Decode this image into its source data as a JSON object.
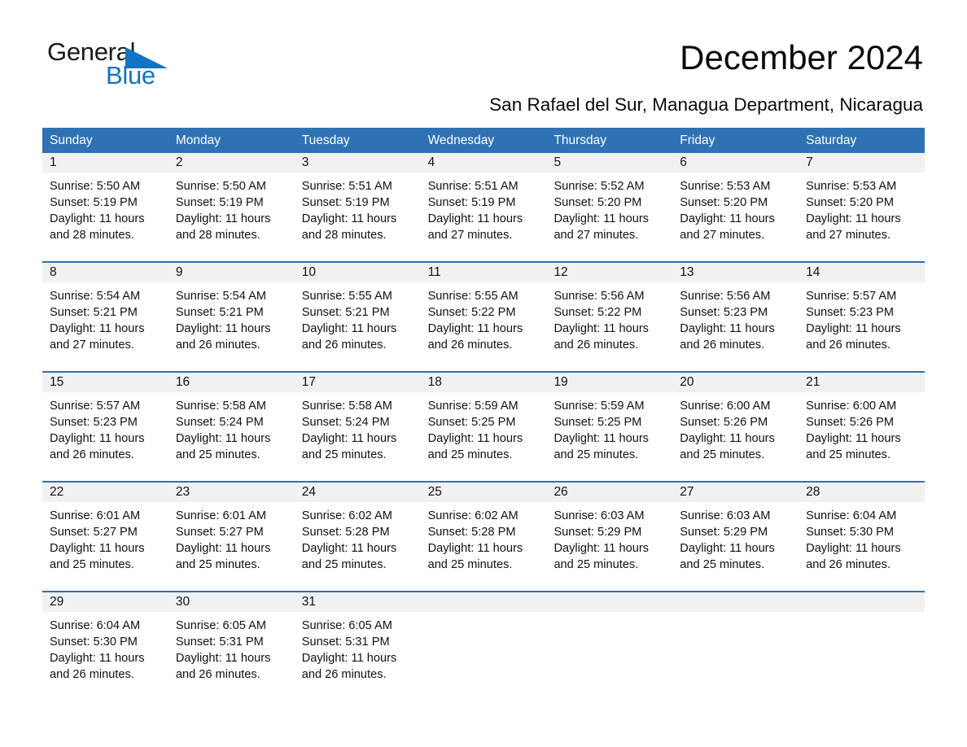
{
  "brand": {
    "name_part1": "General",
    "name_part2": "Blue",
    "triangle_color": "#1273c4"
  },
  "header": {
    "title": "December 2024",
    "subtitle": "San Rafael del Sur, Managua Department, Nicaragua"
  },
  "calendar": {
    "accent_color": "#2e72b4",
    "daynum_band_color": "#f1f1f1",
    "weekday_headers": [
      "Sunday",
      "Monday",
      "Tuesday",
      "Wednesday",
      "Thursday",
      "Friday",
      "Saturday"
    ],
    "weeks": [
      [
        {
          "day": "1",
          "sunrise": "Sunrise: 5:50 AM",
          "sunset": "Sunset: 5:19 PM",
          "daylight_line1": "Daylight: 11 hours",
          "daylight_line2": "and 28 minutes."
        },
        {
          "day": "2",
          "sunrise": "Sunrise: 5:50 AM",
          "sunset": "Sunset: 5:19 PM",
          "daylight_line1": "Daylight: 11 hours",
          "daylight_line2": "and 28 minutes."
        },
        {
          "day": "3",
          "sunrise": "Sunrise: 5:51 AM",
          "sunset": "Sunset: 5:19 PM",
          "daylight_line1": "Daylight: 11 hours",
          "daylight_line2": "and 28 minutes."
        },
        {
          "day": "4",
          "sunrise": "Sunrise: 5:51 AM",
          "sunset": "Sunset: 5:19 PM",
          "daylight_line1": "Daylight: 11 hours",
          "daylight_line2": "and 27 minutes."
        },
        {
          "day": "5",
          "sunrise": "Sunrise: 5:52 AM",
          "sunset": "Sunset: 5:20 PM",
          "daylight_line1": "Daylight: 11 hours",
          "daylight_line2": "and 27 minutes."
        },
        {
          "day": "6",
          "sunrise": "Sunrise: 5:53 AM",
          "sunset": "Sunset: 5:20 PM",
          "daylight_line1": "Daylight: 11 hours",
          "daylight_line2": "and 27 minutes."
        },
        {
          "day": "7",
          "sunrise": "Sunrise: 5:53 AM",
          "sunset": "Sunset: 5:20 PM",
          "daylight_line1": "Daylight: 11 hours",
          "daylight_line2": "and 27 minutes."
        }
      ],
      [
        {
          "day": "8",
          "sunrise": "Sunrise: 5:54 AM",
          "sunset": "Sunset: 5:21 PM",
          "daylight_line1": "Daylight: 11 hours",
          "daylight_line2": "and 27 minutes."
        },
        {
          "day": "9",
          "sunrise": "Sunrise: 5:54 AM",
          "sunset": "Sunset: 5:21 PM",
          "daylight_line1": "Daylight: 11 hours",
          "daylight_line2": "and 26 minutes."
        },
        {
          "day": "10",
          "sunrise": "Sunrise: 5:55 AM",
          "sunset": "Sunset: 5:21 PM",
          "daylight_line1": "Daylight: 11 hours",
          "daylight_line2": "and 26 minutes."
        },
        {
          "day": "11",
          "sunrise": "Sunrise: 5:55 AM",
          "sunset": "Sunset: 5:22 PM",
          "daylight_line1": "Daylight: 11 hours",
          "daylight_line2": "and 26 minutes."
        },
        {
          "day": "12",
          "sunrise": "Sunrise: 5:56 AM",
          "sunset": "Sunset: 5:22 PM",
          "daylight_line1": "Daylight: 11 hours",
          "daylight_line2": "and 26 minutes."
        },
        {
          "day": "13",
          "sunrise": "Sunrise: 5:56 AM",
          "sunset": "Sunset: 5:23 PM",
          "daylight_line1": "Daylight: 11 hours",
          "daylight_line2": "and 26 minutes."
        },
        {
          "day": "14",
          "sunrise": "Sunrise: 5:57 AM",
          "sunset": "Sunset: 5:23 PM",
          "daylight_line1": "Daylight: 11 hours",
          "daylight_line2": "and 26 minutes."
        }
      ],
      [
        {
          "day": "15",
          "sunrise": "Sunrise: 5:57 AM",
          "sunset": "Sunset: 5:23 PM",
          "daylight_line1": "Daylight: 11 hours",
          "daylight_line2": "and 26 minutes."
        },
        {
          "day": "16",
          "sunrise": "Sunrise: 5:58 AM",
          "sunset": "Sunset: 5:24 PM",
          "daylight_line1": "Daylight: 11 hours",
          "daylight_line2": "and 25 minutes."
        },
        {
          "day": "17",
          "sunrise": "Sunrise: 5:58 AM",
          "sunset": "Sunset: 5:24 PM",
          "daylight_line1": "Daylight: 11 hours",
          "daylight_line2": "and 25 minutes."
        },
        {
          "day": "18",
          "sunrise": "Sunrise: 5:59 AM",
          "sunset": "Sunset: 5:25 PM",
          "daylight_line1": "Daylight: 11 hours",
          "daylight_line2": "and 25 minutes."
        },
        {
          "day": "19",
          "sunrise": "Sunrise: 5:59 AM",
          "sunset": "Sunset: 5:25 PM",
          "daylight_line1": "Daylight: 11 hours",
          "daylight_line2": "and 25 minutes."
        },
        {
          "day": "20",
          "sunrise": "Sunrise: 6:00 AM",
          "sunset": "Sunset: 5:26 PM",
          "daylight_line1": "Daylight: 11 hours",
          "daylight_line2": "and 25 minutes."
        },
        {
          "day": "21",
          "sunrise": "Sunrise: 6:00 AM",
          "sunset": "Sunset: 5:26 PM",
          "daylight_line1": "Daylight: 11 hours",
          "daylight_line2": "and 25 minutes."
        }
      ],
      [
        {
          "day": "22",
          "sunrise": "Sunrise: 6:01 AM",
          "sunset": "Sunset: 5:27 PM",
          "daylight_line1": "Daylight: 11 hours",
          "daylight_line2": "and 25 minutes."
        },
        {
          "day": "23",
          "sunrise": "Sunrise: 6:01 AM",
          "sunset": "Sunset: 5:27 PM",
          "daylight_line1": "Daylight: 11 hours",
          "daylight_line2": "and 25 minutes."
        },
        {
          "day": "24",
          "sunrise": "Sunrise: 6:02 AM",
          "sunset": "Sunset: 5:28 PM",
          "daylight_line1": "Daylight: 11 hours",
          "daylight_line2": "and 25 minutes."
        },
        {
          "day": "25",
          "sunrise": "Sunrise: 6:02 AM",
          "sunset": "Sunset: 5:28 PM",
          "daylight_line1": "Daylight: 11 hours",
          "daylight_line2": "and 25 minutes."
        },
        {
          "day": "26",
          "sunrise": "Sunrise: 6:03 AM",
          "sunset": "Sunset: 5:29 PM",
          "daylight_line1": "Daylight: 11 hours",
          "daylight_line2": "and 25 minutes."
        },
        {
          "day": "27",
          "sunrise": "Sunrise: 6:03 AM",
          "sunset": "Sunset: 5:29 PM",
          "daylight_line1": "Daylight: 11 hours",
          "daylight_line2": "and 25 minutes."
        },
        {
          "day": "28",
          "sunrise": "Sunrise: 6:04 AM",
          "sunset": "Sunset: 5:30 PM",
          "daylight_line1": "Daylight: 11 hours",
          "daylight_line2": "and 26 minutes."
        }
      ],
      [
        {
          "day": "29",
          "sunrise": "Sunrise: 6:04 AM",
          "sunset": "Sunset: 5:30 PM",
          "daylight_line1": "Daylight: 11 hours",
          "daylight_line2": "and 26 minutes."
        },
        {
          "day": "30",
          "sunrise": "Sunrise: 6:05 AM",
          "sunset": "Sunset: 5:31 PM",
          "daylight_line1": "Daylight: 11 hours",
          "daylight_line2": "and 26 minutes."
        },
        {
          "day": "31",
          "sunrise": "Sunrise: 6:05 AM",
          "sunset": "Sunset: 5:31 PM",
          "daylight_line1": "Daylight: 11 hours",
          "daylight_line2": "and 26 minutes."
        },
        {
          "day": "",
          "sunrise": "",
          "sunset": "",
          "daylight_line1": "",
          "daylight_line2": ""
        },
        {
          "day": "",
          "sunrise": "",
          "sunset": "",
          "daylight_line1": "",
          "daylight_line2": ""
        },
        {
          "day": "",
          "sunrise": "",
          "sunset": "",
          "daylight_line1": "",
          "daylight_line2": ""
        },
        {
          "day": "",
          "sunrise": "",
          "sunset": "",
          "daylight_line1": "",
          "daylight_line2": ""
        }
      ]
    ]
  }
}
